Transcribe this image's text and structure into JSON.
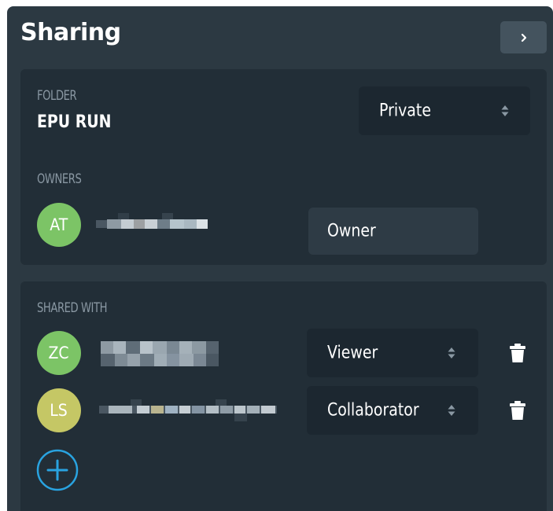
{
  "panel": {
    "title": "Sharing",
    "collapse_icon": "chevron-right-icon"
  },
  "folder_section": {
    "label": "FOLDER",
    "name": "EPU RUN",
    "visibility": {
      "value": "Private",
      "icon": "sort-icon"
    },
    "owners_label": "OWNERS",
    "owners": [
      {
        "initials": "AT",
        "avatar_color": "#7cc466",
        "name_redacted": true,
        "role": "Owner"
      }
    ]
  },
  "shared_section": {
    "label": "SHARED WITH",
    "members": [
      {
        "initials": "ZC",
        "avatar_color": "#7cc466",
        "name_redacted": true,
        "role": "Viewer",
        "role_icon": "sort-icon",
        "delete_icon": "trash-icon"
      },
      {
        "initials": "LS",
        "avatar_color": "#c5c765",
        "name_redacted": true,
        "role": "Collaborator",
        "role_icon": "sort-icon",
        "delete_icon": "trash-icon"
      }
    ],
    "add_icon": "plus-circle-icon"
  },
  "colors": {
    "panel_bg": "#2c3942",
    "card_bg": "#222e37",
    "select_bg": "#1c2730",
    "label_color": "#8a98a3",
    "accent_blue": "#29a3e0"
  }
}
